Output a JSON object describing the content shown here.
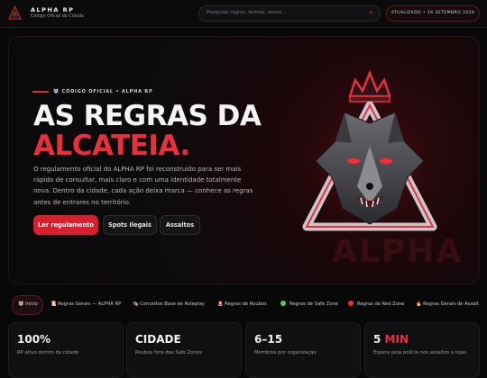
{
  "header": {
    "brand_title": "ALPHA RP",
    "brand_subtitle": "Código Oficial da Cidade",
    "search_placeholder": "Pesquisar regras, termos, zonas...",
    "search_icon": "arrow-icon",
    "updated_label": "ATUALIZADO • 16 SETEMBRO 2026"
  },
  "hero": {
    "eyebrow": "CÓDIGO OFICIAL • ALPHA RP",
    "title_line1": "AS REGRAS DA",
    "title_line2": "ALCATEIA.",
    "description": "O regulamento oficial do ALPHA RP foi reconstruído para ser mais rápido de consultar, mais claro e com uma identidade totalmente nova. Dentro da cidade, cada ação deixa marca — conhece as regras antes de entrares no território.",
    "buttons": {
      "primary": "Ler regulamento",
      "secondary1": "Spots Ilegais",
      "secondary2": "Assaltos"
    },
    "watermark": "ALPHA"
  },
  "nav": {
    "items": [
      {
        "label": "Início",
        "icon": "wolf-icon"
      },
      {
        "label": "Regras Gerais — ALPHA RP",
        "icon": "scroll-icon"
      },
      {
        "label": "Conceitos Base de Roleplay",
        "icon": "mask-icon"
      },
      {
        "label": "Regras de Roubos",
        "icon": "siren-icon"
      },
      {
        "label": "Regras de Safe Zone",
        "icon": "green-dot-icon"
      },
      {
        "label": "Regras de Red Zone",
        "icon": "red-dot-icon"
      },
      {
        "label": "Regras Gerais de Assalt",
        "icon": "fire-icon"
      }
    ]
  },
  "stats": [
    {
      "value": "100%",
      "label": "RP ativo dentro da cidade"
    },
    {
      "value": "CIDADE",
      "label": "Roubos fora das Safe Zones"
    },
    {
      "value": "6–15",
      "label": "Membros por organização"
    },
    {
      "value_num": "5",
      "value_unit": "MIN",
      "label": "Espera pela polícia nos assaltos a lojas"
    }
  ],
  "colors": {
    "accent": "#e02735",
    "background": "#080809"
  }
}
